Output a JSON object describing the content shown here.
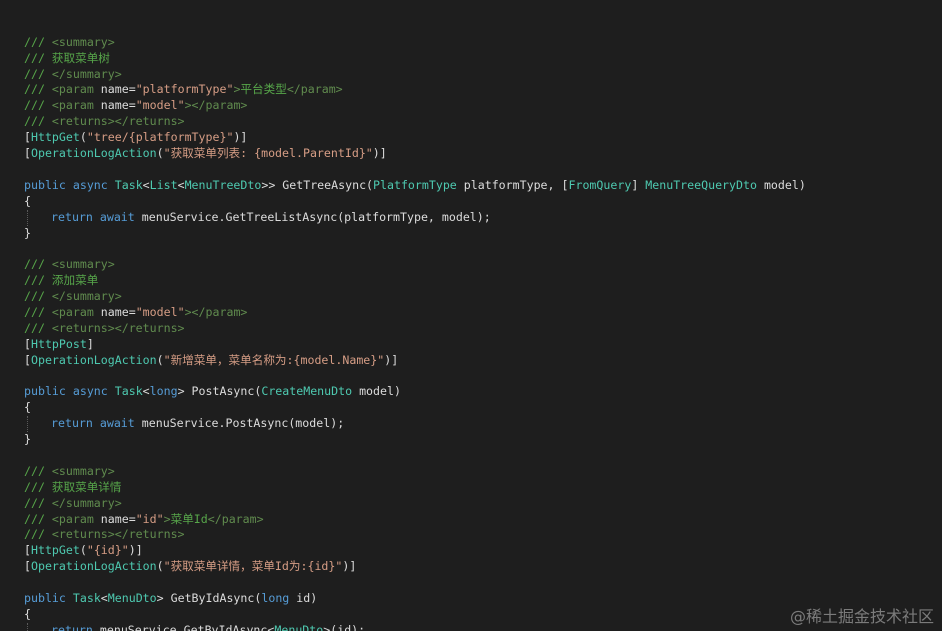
{
  "colors": {
    "background": "#1e1e1e",
    "comment": "#57a64a",
    "xml_tag": "#608b4e",
    "keyword": "#569cd6",
    "type": "#4ec9b0",
    "string": "#d69d85",
    "default": "#dcdcdc"
  },
  "lines": [
    {
      "indent": false,
      "tokens": [
        {
          "c": "comment",
          "t": "/// "
        },
        {
          "c": "xmltag",
          "t": "<summary>"
        }
      ]
    },
    {
      "indent": false,
      "tokens": [
        {
          "c": "comment",
          "t": "/// 获取菜单树"
        }
      ]
    },
    {
      "indent": false,
      "tokens": [
        {
          "c": "comment",
          "t": "/// "
        },
        {
          "c": "xmltag",
          "t": "</summary>"
        }
      ]
    },
    {
      "indent": false,
      "tokens": [
        {
          "c": "comment",
          "t": "/// "
        },
        {
          "c": "xmltag",
          "t": "<param "
        },
        {
          "c": "default",
          "t": "name="
        },
        {
          "c": "string",
          "t": "\"platformType\""
        },
        {
          "c": "xmltag",
          "t": ">"
        },
        {
          "c": "comment",
          "t": "平台类型"
        },
        {
          "c": "xmltag",
          "t": "</param>"
        }
      ]
    },
    {
      "indent": false,
      "tokens": [
        {
          "c": "comment",
          "t": "/// "
        },
        {
          "c": "xmltag",
          "t": "<param "
        },
        {
          "c": "default",
          "t": "name="
        },
        {
          "c": "string",
          "t": "\"model\""
        },
        {
          "c": "xmltag",
          "t": "></param>"
        }
      ]
    },
    {
      "indent": false,
      "tokens": [
        {
          "c": "comment",
          "t": "/// "
        },
        {
          "c": "xmltag",
          "t": "<returns></returns>"
        }
      ]
    },
    {
      "indent": false,
      "tokens": [
        {
          "c": "default",
          "t": "["
        },
        {
          "c": "type",
          "t": "HttpGet"
        },
        {
          "c": "default",
          "t": "("
        },
        {
          "c": "string",
          "t": "\"tree/{platformType}\""
        },
        {
          "c": "default",
          "t": ")]"
        }
      ]
    },
    {
      "indent": false,
      "tokens": [
        {
          "c": "default",
          "t": "["
        },
        {
          "c": "type",
          "t": "OperationLogAction"
        },
        {
          "c": "default",
          "t": "("
        },
        {
          "c": "string",
          "t": "\"获取菜单列表: {model.ParentId}\""
        },
        {
          "c": "default",
          "t": ")]"
        }
      ]
    },
    {
      "indent": false,
      "tokens": []
    },
    {
      "indent": false,
      "tokens": [
        {
          "c": "keyword",
          "t": "public async "
        },
        {
          "c": "type",
          "t": "Task"
        },
        {
          "c": "default",
          "t": "<"
        },
        {
          "c": "type",
          "t": "List"
        },
        {
          "c": "default",
          "t": "<"
        },
        {
          "c": "type",
          "t": "MenuTreeDto"
        },
        {
          "c": "default",
          "t": ">> GetTreeAsync("
        },
        {
          "c": "type",
          "t": "PlatformType"
        },
        {
          "c": "default",
          "t": " platformType, ["
        },
        {
          "c": "type",
          "t": "FromQuery"
        },
        {
          "c": "default",
          "t": "] "
        },
        {
          "c": "type",
          "t": "MenuTreeQueryDto"
        },
        {
          "c": "default",
          "t": " model)"
        }
      ]
    },
    {
      "indent": false,
      "tokens": [
        {
          "c": "default",
          "t": "{"
        }
      ]
    },
    {
      "indent": true,
      "tokens": [
        {
          "c": "keyword",
          "t": "return await "
        },
        {
          "c": "default",
          "t": "menuService.GetTreeListAsync(platformType, model);"
        }
      ]
    },
    {
      "indent": false,
      "tokens": [
        {
          "c": "default",
          "t": "}"
        }
      ]
    },
    {
      "indent": false,
      "tokens": []
    },
    {
      "indent": false,
      "tokens": [
        {
          "c": "comment",
          "t": "/// "
        },
        {
          "c": "xmltag",
          "t": "<summary>"
        }
      ]
    },
    {
      "indent": false,
      "tokens": [
        {
          "c": "comment",
          "t": "/// 添加菜单"
        }
      ]
    },
    {
      "indent": false,
      "tokens": [
        {
          "c": "comment",
          "t": "/// "
        },
        {
          "c": "xmltag",
          "t": "</summary>"
        }
      ]
    },
    {
      "indent": false,
      "tokens": [
        {
          "c": "comment",
          "t": "/// "
        },
        {
          "c": "xmltag",
          "t": "<param "
        },
        {
          "c": "default",
          "t": "name="
        },
        {
          "c": "string",
          "t": "\"model\""
        },
        {
          "c": "xmltag",
          "t": "></param>"
        }
      ]
    },
    {
      "indent": false,
      "tokens": [
        {
          "c": "comment",
          "t": "/// "
        },
        {
          "c": "xmltag",
          "t": "<returns></returns>"
        }
      ]
    },
    {
      "indent": false,
      "tokens": [
        {
          "c": "default",
          "t": "["
        },
        {
          "c": "type",
          "t": "HttpPost"
        },
        {
          "c": "default",
          "t": "]"
        }
      ]
    },
    {
      "indent": false,
      "tokens": [
        {
          "c": "default",
          "t": "["
        },
        {
          "c": "type",
          "t": "OperationLogAction"
        },
        {
          "c": "default",
          "t": "("
        },
        {
          "c": "string",
          "t": "\"新增菜单，菜单名称为:{model.Name}\""
        },
        {
          "c": "default",
          "t": ")]"
        }
      ]
    },
    {
      "indent": false,
      "tokens": []
    },
    {
      "indent": false,
      "tokens": [
        {
          "c": "keyword",
          "t": "public async "
        },
        {
          "c": "type",
          "t": "Task"
        },
        {
          "c": "default",
          "t": "<"
        },
        {
          "c": "keyword",
          "t": "long"
        },
        {
          "c": "default",
          "t": "> PostAsync("
        },
        {
          "c": "type",
          "t": "CreateMenuDto"
        },
        {
          "c": "default",
          "t": " model)"
        }
      ]
    },
    {
      "indent": false,
      "tokens": [
        {
          "c": "default",
          "t": "{"
        }
      ]
    },
    {
      "indent": true,
      "tokens": [
        {
          "c": "keyword",
          "t": "return await "
        },
        {
          "c": "default",
          "t": "menuService.PostAsync(model);"
        }
      ]
    },
    {
      "indent": false,
      "tokens": [
        {
          "c": "default",
          "t": "}"
        }
      ]
    },
    {
      "indent": false,
      "tokens": []
    },
    {
      "indent": false,
      "tokens": [
        {
          "c": "comment",
          "t": "/// "
        },
        {
          "c": "xmltag",
          "t": "<summary>"
        }
      ]
    },
    {
      "indent": false,
      "tokens": [
        {
          "c": "comment",
          "t": "/// 获取菜单详情"
        }
      ]
    },
    {
      "indent": false,
      "tokens": [
        {
          "c": "comment",
          "t": "/// "
        },
        {
          "c": "xmltag",
          "t": "</summary>"
        }
      ]
    },
    {
      "indent": false,
      "tokens": [
        {
          "c": "comment",
          "t": "/// "
        },
        {
          "c": "xmltag",
          "t": "<param "
        },
        {
          "c": "default",
          "t": "name="
        },
        {
          "c": "string",
          "t": "\"id\""
        },
        {
          "c": "xmltag",
          "t": ">"
        },
        {
          "c": "comment",
          "t": "菜单Id"
        },
        {
          "c": "xmltag",
          "t": "</param>"
        }
      ]
    },
    {
      "indent": false,
      "tokens": [
        {
          "c": "comment",
          "t": "/// "
        },
        {
          "c": "xmltag",
          "t": "<returns></returns>"
        }
      ]
    },
    {
      "indent": false,
      "tokens": [
        {
          "c": "default",
          "t": "["
        },
        {
          "c": "type",
          "t": "HttpGet"
        },
        {
          "c": "default",
          "t": "("
        },
        {
          "c": "string",
          "t": "\"{id}\""
        },
        {
          "c": "default",
          "t": ")]"
        }
      ]
    },
    {
      "indent": false,
      "tokens": [
        {
          "c": "default",
          "t": "["
        },
        {
          "c": "type",
          "t": "OperationLogAction"
        },
        {
          "c": "default",
          "t": "("
        },
        {
          "c": "string",
          "t": "\"获取菜单详情，菜单Id为:{id}\""
        },
        {
          "c": "default",
          "t": ")]"
        }
      ]
    },
    {
      "indent": false,
      "tokens": []
    },
    {
      "indent": false,
      "tokens": [
        {
          "c": "keyword",
          "t": "public "
        },
        {
          "c": "type",
          "t": "Task"
        },
        {
          "c": "default",
          "t": "<"
        },
        {
          "c": "type",
          "t": "MenuDto"
        },
        {
          "c": "default",
          "t": "> GetByIdAsync("
        },
        {
          "c": "keyword",
          "t": "long"
        },
        {
          "c": "default",
          "t": " id)"
        }
      ]
    },
    {
      "indent": false,
      "tokens": [
        {
          "c": "default",
          "t": "{"
        }
      ]
    },
    {
      "indent": true,
      "tokens": [
        {
          "c": "keyword",
          "t": "return "
        },
        {
          "c": "default",
          "t": "menuService.GetByIdAsync<"
        },
        {
          "c": "type",
          "t": "MenuDto"
        },
        {
          "c": "default",
          "t": ">(id);"
        }
      ]
    },
    {
      "indent": false,
      "tokens": [
        {
          "c": "default",
          "t": "}"
        }
      ]
    }
  ],
  "watermark": "@稀土掘金技术社区"
}
